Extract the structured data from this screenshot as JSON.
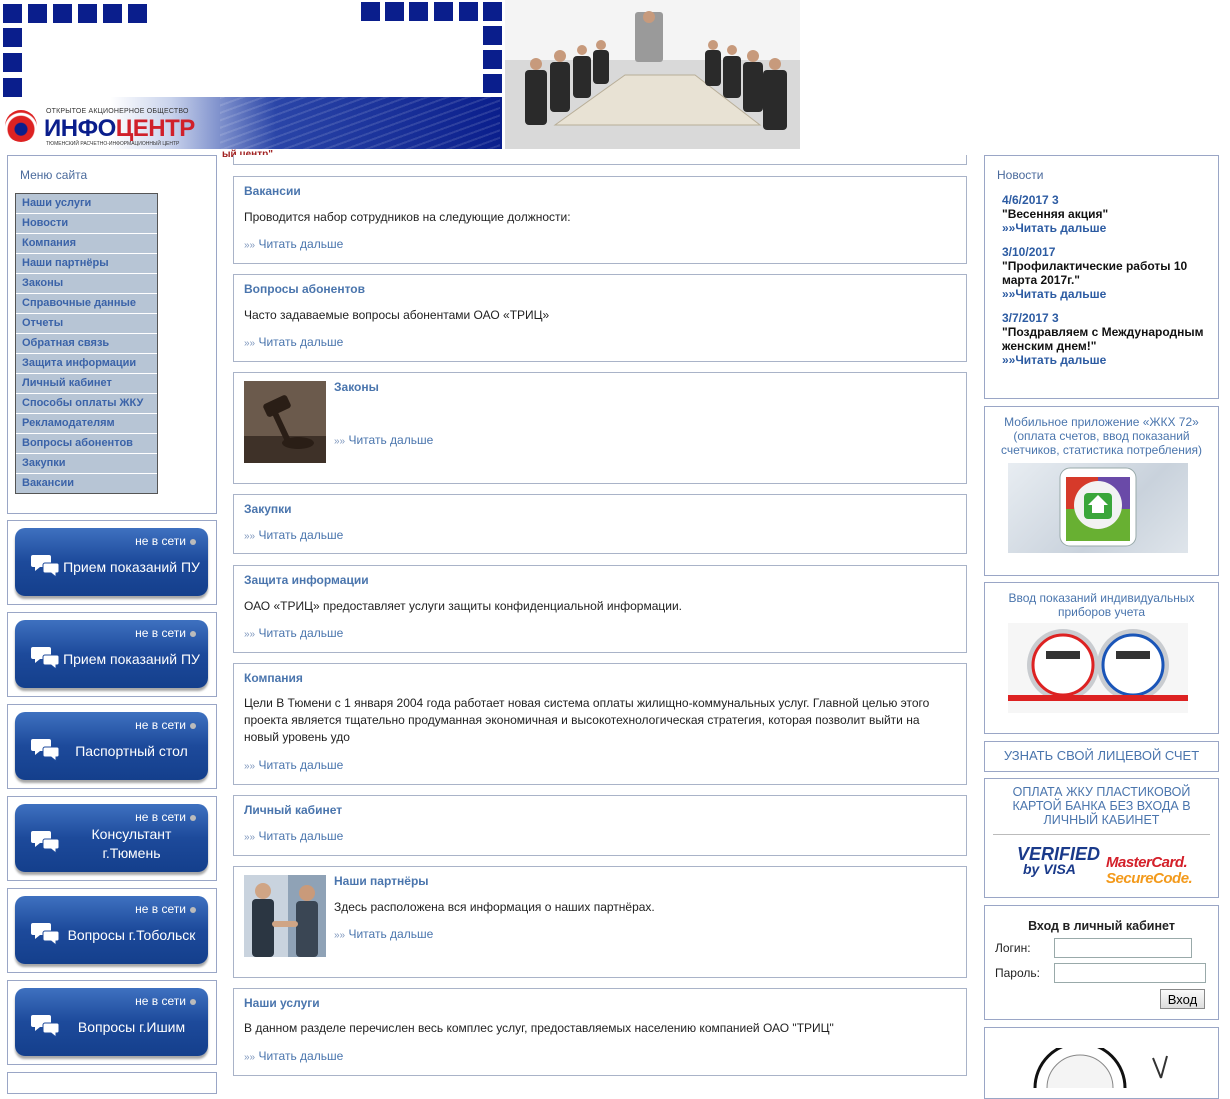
{
  "header": {
    "logo_top": "ОТКРЫТОЕ АКЦИОНЕРНОЕ ОБЩЕСТВО",
    "logo_main_1": "ИНФО",
    "logo_main_2": "ЦЕНТР",
    "logo_sub": "ТЮМЕНСКИЙ РАСЧЕТНО-ИНФОРМАЦИОННЫЙ ЦЕНТР",
    "fragment_text": "ый центр\""
  },
  "sidebar": {
    "menu_title": "Меню сайта",
    "menu_items": [
      {
        "label": "Наши услуги"
      },
      {
        "label": "Новости"
      },
      {
        "label": "Компания"
      },
      {
        "label": "Наши партнёры"
      },
      {
        "label": "Законы"
      },
      {
        "label": "Справочные данные"
      },
      {
        "label": "Отчеты"
      },
      {
        "label": "Обратная связь"
      },
      {
        "label": "Защита информации"
      },
      {
        "label": "Личный кабинет"
      },
      {
        "label": "Способы оплаты ЖКУ"
      },
      {
        "label": "Рекламодателям"
      },
      {
        "label": "Вопросы абонентов"
      },
      {
        "label": "Закупки"
      },
      {
        "label": "Вакансии"
      }
    ],
    "chats": [
      {
        "status": "не в сети",
        "label": "Прием показаний ПУ"
      },
      {
        "status": "не в сети",
        "label": "Прием показаний ПУ"
      },
      {
        "status": "не в сети",
        "label": "Паспортный стол"
      },
      {
        "status": "не в сети",
        "label": "Консультант г.Тюмень"
      },
      {
        "status": "не в сети",
        "label": "Вопросы г.Тобольск"
      },
      {
        "status": "не в сети",
        "label": "Вопросы г.Ишим"
      }
    ]
  },
  "main": {
    "more_label": "Читать дальше",
    "more_prefix": "»»",
    "cards": [
      {
        "title": "Вакансии",
        "text": "Проводится набор сотрудников на следующие должности:"
      },
      {
        "title": "Вопросы абонентов",
        "text": "Часто задаваемые вопросы абонентами ОАО «ТРИЦ»"
      },
      {
        "title": "Законы",
        "text": ""
      },
      {
        "title": "Закупки",
        "text": ""
      },
      {
        "title": "Защита информации",
        "text": "ОАО «ТРИЦ» предоставляет услуги защиты конфиденциальной информации."
      },
      {
        "title": "Компания",
        "text": "Цели В Тюмени с 1 января 2004 года работает новая система оплаты жилищно-коммунальных услуг. Главной целью этого проекта является тщательно продуманная экономичная и высокотехнологическая стратегия, которая позволит выйти на новый уровень удо"
      },
      {
        "title": "Личный кабинет",
        "text": ""
      },
      {
        "title": "Наши партнёры",
        "text": "Здесь расположена вся информация о наших партнёрах."
      },
      {
        "title": "Наши услуги",
        "text": "В данном разделе перечислен весь комплес услуг, предоставляемых населению компанией ОАО \"ТРИЦ\""
      }
    ]
  },
  "right": {
    "news_title": "Новости",
    "news": [
      {
        "date": "4/6/2017 3",
        "headline": "\"Весенняя акция\"",
        "more": "»»Читать дальше"
      },
      {
        "date": "3/10/2017",
        "headline": "\"Профилактические работы 10 марта 2017г.\"",
        "more": "»»Читать дальше"
      },
      {
        "date": "3/7/2017 3",
        "headline": "\"Поздравляем с Международным женским днем!\"",
        "more": "»»Читать дальше"
      }
    ],
    "app_text": "Мобильное приложение «ЖКХ 72» (оплата счетов, ввод показаний счетчиков, статистика потребления)",
    "meters_text": "Ввод показаний индивидуальных приборов учета",
    "account_link": "УЗНАТЬ СВОЙ ЛИЦЕВОЙ СЧЕТ",
    "card_pay_text": "ОПЛАТА ЖКУ ПЛАСТИКОВОЙ КАРТОЙ БАНКА БЕЗ ВХОДА В ЛИЧНЫЙ КАБИНЕТ",
    "verified_1": "VERIFIED",
    "verified_2": "by VISA",
    "mc_1": "MasterCard.",
    "mc_2": "SecureCode.",
    "login": {
      "title": "Вход в личный кабинет",
      "login_label": "Логин:",
      "password_label": "Пароль:",
      "button": "Вход"
    }
  },
  "colors": {
    "brand_blue": "#0a1e8c",
    "link": "#4a75ad",
    "menu_bg": "#b7c5d5",
    "chat_button": "#1d4a9b",
    "logo_red": "#d0202a"
  }
}
